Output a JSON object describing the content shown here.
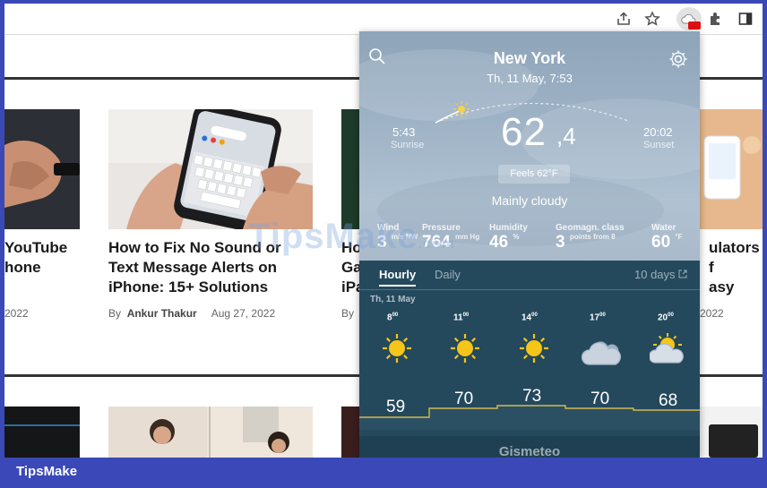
{
  "weather": {
    "city": "New York",
    "datetime": "Th, 11 May, 7:53",
    "temp_whole": "62",
    "temp_frac": ",4",
    "sunrise": {
      "time": "5:43",
      "label": "Sunrise"
    },
    "sunset": {
      "time": "20:02",
      "label": "Sunset"
    },
    "feels": "Feels  62°F",
    "condition": "Mainly cloudy",
    "stats": [
      {
        "label": "Wind",
        "value": "3",
        "unit": "m/s NW"
      },
      {
        "label": "Pressure",
        "value": "764",
        "unit": "mm Hg"
      },
      {
        "label": "Humidity",
        "value": "46",
        "unit": "%"
      },
      {
        "label": "Geomagn. class",
        "value": "3",
        "unit": "points from 8"
      },
      {
        "label": "Water",
        "value": "60",
        "unit": "°F"
      }
    ],
    "tabs": {
      "hourly": "Hourly",
      "daily": "Daily",
      "ten_days": "10 days"
    },
    "day_label": "Th, 11 May",
    "hourly": [
      {
        "hour": "8",
        "min": "00",
        "icon": "sun-icon",
        "temp": "59"
      },
      {
        "hour": "11",
        "min": "00",
        "icon": "sun-icon",
        "temp": "70"
      },
      {
        "hour": "14",
        "min": "00",
        "icon": "sun-icon",
        "temp": "73"
      },
      {
        "hour": "17",
        "min": "00",
        "icon": "cloud-icon",
        "temp": "70"
      },
      {
        "hour": "20",
        "min": "00",
        "icon": "partly-cloudy-icon",
        "temp": "68"
      }
    ],
    "credit": "Gismeteo"
  },
  "articles": [
    {
      "title_lines": [
        "YouTube",
        "hone"
      ],
      "date": "2022"
    },
    {
      "title_lines": [
        "How to Fix No Sound or",
        "Text Message Alerts on",
        "iPhone: 15+ Solutions"
      ],
      "by": "By",
      "author": "Ankur Thakur",
      "date": "Aug 27, 2022"
    },
    {
      "title_lines": [
        "Ho",
        "Ga",
        "iPa"
      ],
      "by": "By"
    },
    {
      "title_lines": [
        "ulators f",
        "asy"
      ],
      "date": "2022"
    }
  ],
  "watermark": {
    "text": "TipsMake",
    "suffix": ".com"
  },
  "footer_brand": "TipsMake",
  "colors": {
    "frame": "#3a48b8",
    "popup_dark": "#24495d",
    "sun": "#f5c518"
  }
}
